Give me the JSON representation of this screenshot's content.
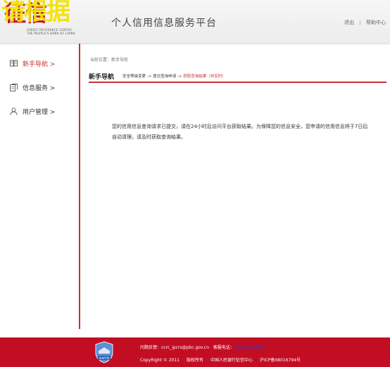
{
  "header": {
    "logo_watermark": "请根据",
    "logo_mark": "征信",
    "logo_en_line1": "CREDIT REFERENCE CENTER",
    "logo_en_line2": "THE PEOPLE'S BANK OF CHINA",
    "title": "个人信用信息服务平台",
    "logout": "退出",
    "separator": "|",
    "help": "帮助中心"
  },
  "sidebar": {
    "items": [
      {
        "label": "新手导航 >",
        "icon": "book-icon",
        "active": true
      },
      {
        "label": "信息服务 >",
        "icon": "notes-icon",
        "active": false
      },
      {
        "label": "用户管理 >",
        "icon": "user-icon",
        "active": false
      }
    ]
  },
  "main": {
    "breadcrumb": "当前位置：新手导航",
    "section_title": "新手导航",
    "steps": {
      "step1": "安全等级变更",
      "arrow": "->",
      "step2": "提交查询申请",
      "step3": "获取查询结果（非实时）"
    },
    "message": "您的信用信息查询请求已提交，请在24小时后访问平台获取结果。为保障您的信息安全，您申请的信用信息将于7日后自动清理，请及时获取查询结果。"
  },
  "footer": {
    "feedback_label": "问题反馈：",
    "feedback_email": "ccrc_ipcrs@pbc.gov.cn",
    "phone_label": "客服电话：",
    "phone": "400-810-8866",
    "copyright": "CopyRight © 2011",
    "rights": "版权所有",
    "org": "中国人民银行征信中心",
    "icp": "沪ICP备08016794号",
    "badge_text": "安全可信"
  },
  "colors": {
    "accent_red": "#c8302e",
    "footer_red": "#c30d23"
  }
}
